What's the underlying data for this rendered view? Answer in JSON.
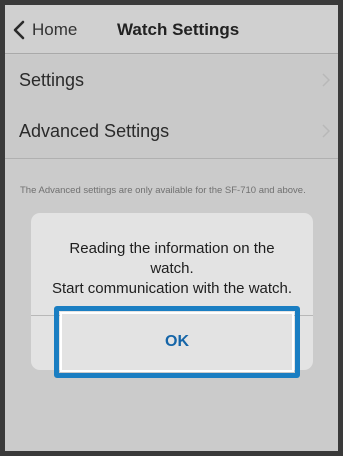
{
  "navbar": {
    "back_label": "Home",
    "title": "Watch Settings",
    "back_icon": "chevron-left-icon"
  },
  "rows": [
    {
      "label": "Settings",
      "icon": "chevron-right-icon"
    },
    {
      "label": "Advanced Settings",
      "icon": "chevron-right-icon"
    }
  ],
  "footnote": "The Advanced settings are only available for the SF-710 and above.",
  "dialog": {
    "message_line1": "Reading the information on the",
    "message_line2": "watch.",
    "message_line3": "Start communication with the watch.",
    "ok_label": "OK"
  },
  "colors": {
    "highlight": "#1a7ec2",
    "ok_text": "#1565a8"
  }
}
